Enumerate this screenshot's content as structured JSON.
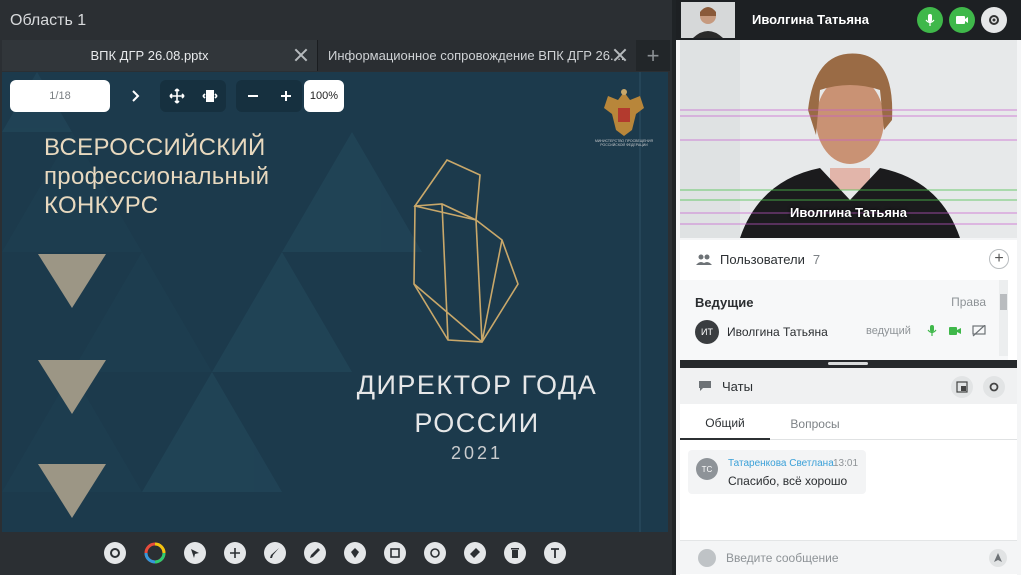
{
  "area": {
    "title": "Область 1"
  },
  "tabs": [
    {
      "label": "ВПК ДГР 26.08.pptx",
      "active": true
    },
    {
      "label": "Информационное сопровождение ВПК ДГР 26...."
    }
  ],
  "slide_controls": {
    "page": "1/18",
    "zoom": "100%"
  },
  "slide": {
    "headline": [
      "ВСЕРОССИЙСКИЙ",
      "профессиональный",
      "КОНКУРС"
    ],
    "title_line1": "ДИРЕКТОР ГОДА",
    "title_line2": "РОССИИ",
    "year": "2021",
    "emblem_caption": "МИНИСТЕРСТВО ПРОСВЕЩЕНИЯ РОССИЙСКОЙ ФЕДЕРАЦИИ"
  },
  "toolbar": {
    "tools": [
      "gear-icon",
      "color-wheel-icon",
      "pointer-icon",
      "move-icon",
      "brush-icon",
      "pencil-icon",
      "pen-icon",
      "rectangle-icon",
      "circle-icon",
      "eraser-icon",
      "trash-icon",
      "text-icon"
    ]
  },
  "video": {
    "header_name": "Иволгина Татьяна",
    "label": "Иволгина Татьяна",
    "mic_color": "#3fb84a",
    "cam_color": "#3fb84a"
  },
  "users": {
    "title": "Пользователи",
    "count": "7",
    "hosts_label": "Ведущие",
    "rights_label": "Права",
    "host": {
      "initials": "ИТ",
      "name": "Иволгина Татьяна",
      "role": "ведущий"
    }
  },
  "chat": {
    "title": "Чаты",
    "tabs": [
      "Общий",
      "Вопросы"
    ],
    "message": {
      "initials": "ТС",
      "author": "Татаренкова Светлана",
      "time": "13:01",
      "text": "Спасибо, всё хорошо"
    },
    "input_placeholder": "Введите сообщение"
  }
}
